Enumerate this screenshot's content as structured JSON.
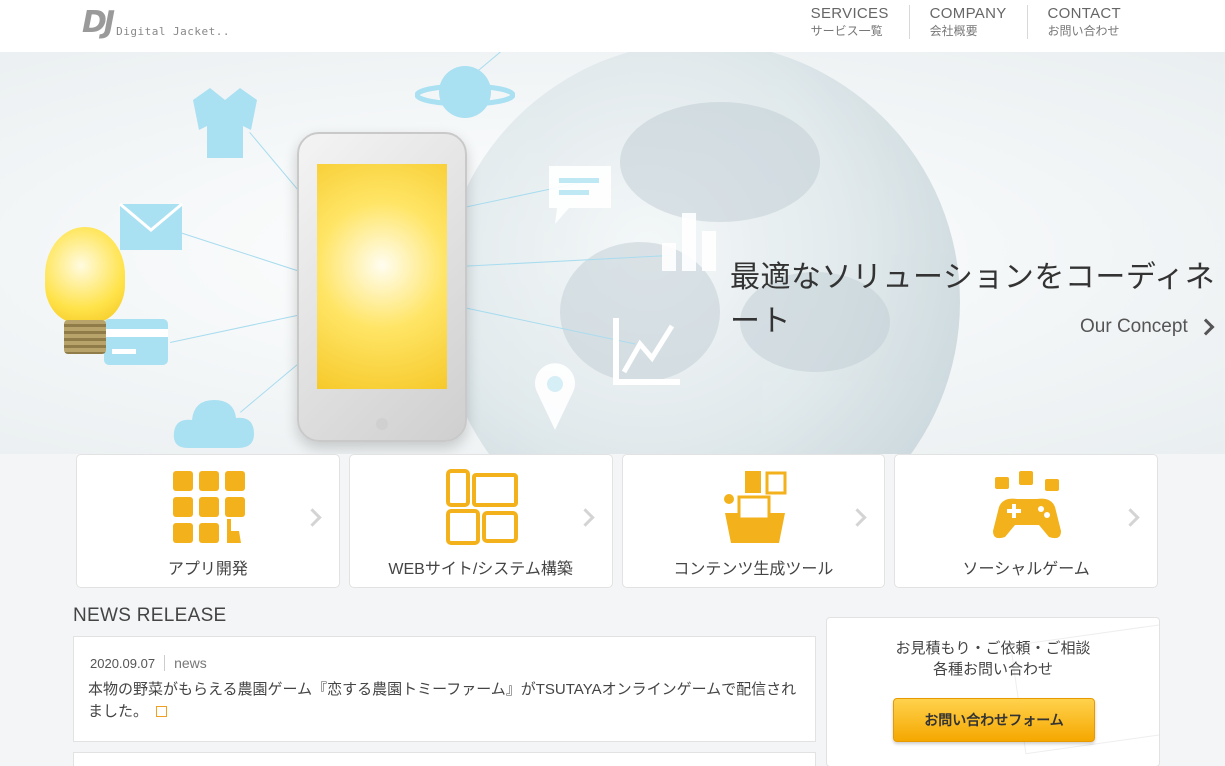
{
  "header": {
    "logo_mark": "DJ",
    "logo_text": "Digital Jacket..",
    "nav": [
      {
        "en": "SERVICES",
        "ja": "サービス一覧"
      },
      {
        "en": "COMPANY",
        "ja": "会社概要"
      },
      {
        "en": "CONTACT",
        "ja": "お問い合わせ"
      }
    ]
  },
  "hero": {
    "headline": "最適なソリューションをコーディネート",
    "concept_link": "Our Concept",
    "icons": [
      "jacket-icon",
      "planet-icon",
      "mail-icon",
      "credit-card-icon",
      "cloud-icon",
      "chat-icon",
      "bar-chart-icon",
      "line-chart-icon",
      "map-pin-icon",
      "lightbulb-icon",
      "smartphone-icon"
    ]
  },
  "services": [
    {
      "label": "アプリ開発",
      "icon": "app-grid-icon"
    },
    {
      "label": "WEBサイト/システム構築",
      "icon": "devices-icon"
    },
    {
      "label": "コンテンツ生成ツール",
      "icon": "content-basket-icon"
    },
    {
      "label": "ソーシャルゲーム",
      "icon": "gamepad-icon"
    }
  ],
  "news": {
    "title": "NEWS RELEASE",
    "items": [
      {
        "date": "2020.09.07",
        "category": "news",
        "text": "本物の野菜がもらえる農園ゲーム『恋する農園トミーファーム』がTSUTAYAオンラインゲームで配信されました。"
      }
    ]
  },
  "contact": {
    "line1": "お見積もり・ご依頼・ご相談",
    "line2": "各種お問い合わせ",
    "button": "お問い合わせフォーム"
  },
  "colors": {
    "accent": "#f5a800",
    "icon_orange": "#f3b21b",
    "hero_icon_blue": "#a9e0f2"
  }
}
